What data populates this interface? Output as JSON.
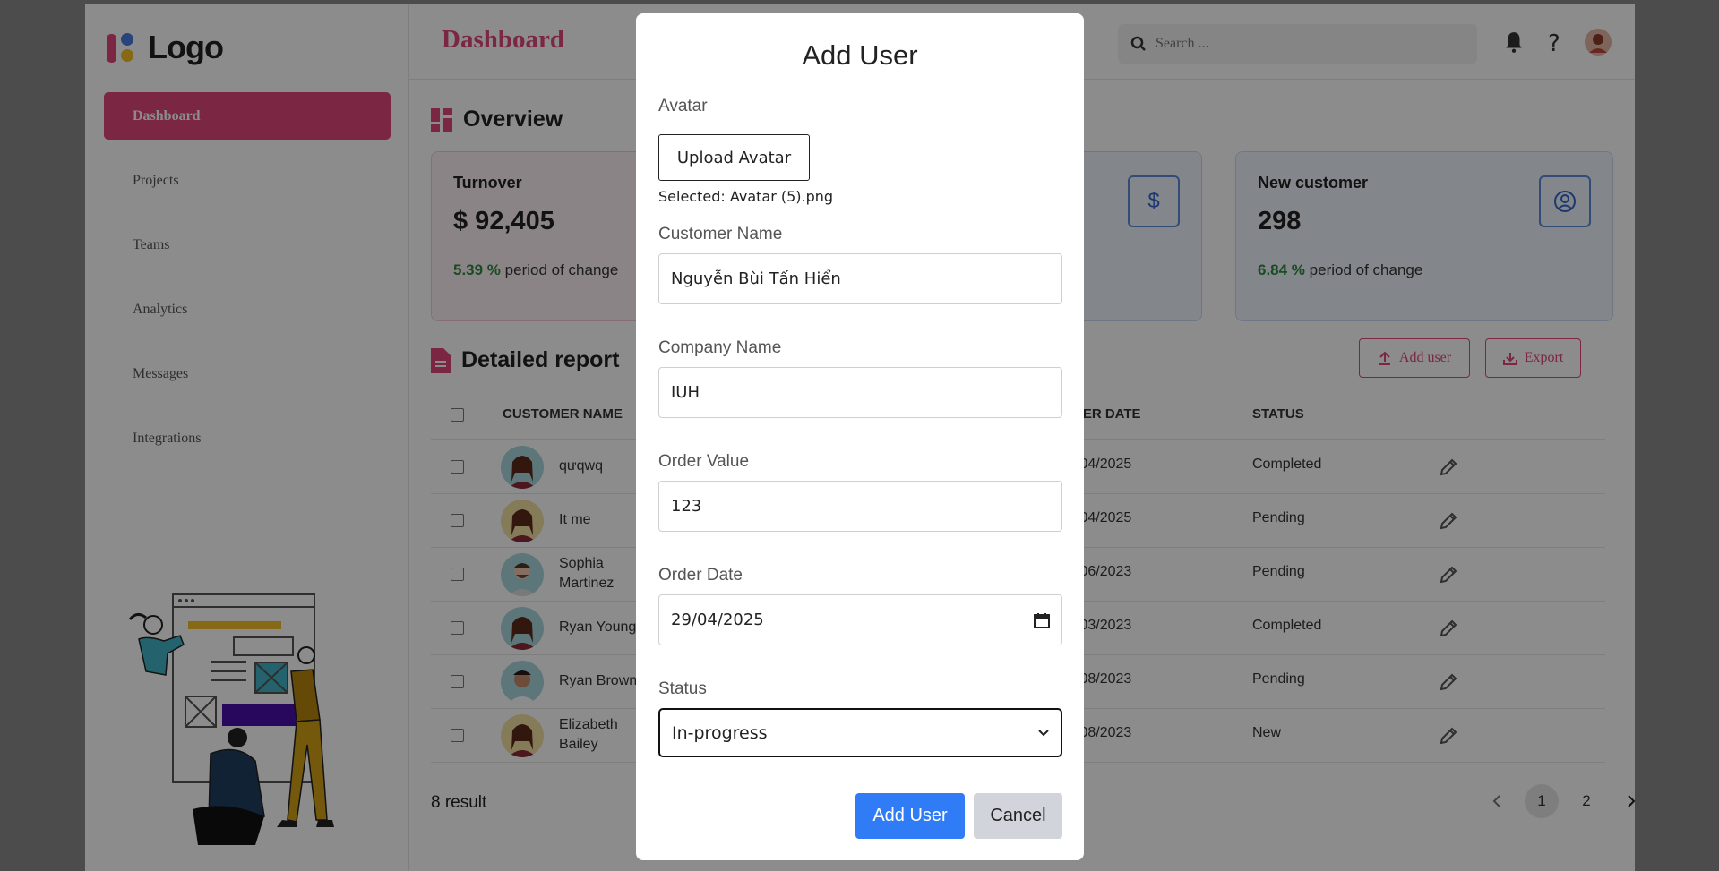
{
  "logo": {
    "text": "Logo"
  },
  "sidebar": {
    "items": [
      {
        "label": "Dashboard"
      },
      {
        "label": "Projects"
      },
      {
        "label": "Teams"
      },
      {
        "label": "Analytics"
      },
      {
        "label": "Messages"
      },
      {
        "label": "Integrations"
      }
    ]
  },
  "header": {
    "title": "Dashboard",
    "search_placeholder": "Search ..."
  },
  "overview": {
    "title": "Overview",
    "cards": [
      {
        "title": "Turnover",
        "value": "$ 92,405",
        "change": "5.39 %",
        "change_text": "period of change"
      },
      {
        "icon": "dollar-icon"
      },
      {
        "title": "New customer",
        "value": "298",
        "change": "6.84 %",
        "change_text": "period of change",
        "icon": "user-circle-icon"
      }
    ]
  },
  "report": {
    "title": "Detailed report",
    "add_user_label": "Add user",
    "export_label": "Export",
    "columns": {
      "customer": "CUSTOMER NAME",
      "order_date": "DER DATE",
      "status": "STATUS"
    },
    "rows": [
      {
        "name": "qưqwq",
        "date": "/04/2025",
        "status": "Completed"
      },
      {
        "name": "It me",
        "date": "/04/2025",
        "status": "Pending"
      },
      {
        "name": "Sophia Martinez",
        "date": "/06/2023",
        "status": "Pending"
      },
      {
        "name": "Ryan Young",
        "date": "/03/2023",
        "status": "Completed"
      },
      {
        "name": "Ryan Brown",
        "date": "/08/2023",
        "status": "Pending"
      },
      {
        "name": "Elizabeth Bailey",
        "date": "/08/2023",
        "status": "New"
      }
    ],
    "result": "8 result",
    "pages": [
      "1",
      "2"
    ]
  },
  "modal": {
    "title": "Add User",
    "avatar_label": "Avatar",
    "upload_label": "Upload Avatar",
    "selected_text": "Selected: Avatar (5).png",
    "customer_label": "Customer Name",
    "customer_value": "Nguyễn Bùi Tấn Hiển",
    "company_label": "Company Name",
    "company_value": "IUH",
    "order_value_label": "Order Value",
    "order_value": "123",
    "order_date_label": "Order Date",
    "order_date": "29/04/2025",
    "status_label": "Status",
    "status_value": "In-progress",
    "submit_label": "Add User",
    "cancel_label": "Cancel"
  },
  "colors": {
    "accent": "#e0457b",
    "primary": "#2f7cf6",
    "positive": "#2e8a3e"
  }
}
